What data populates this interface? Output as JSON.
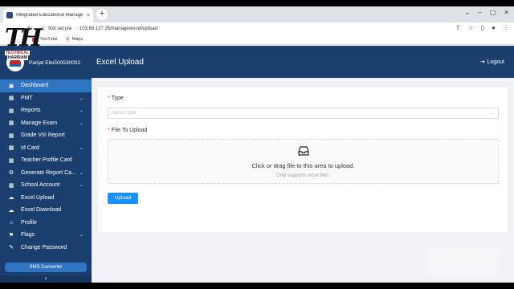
{
  "browser": {
    "tab_title": "Integrated Educational Manage",
    "tab_close": "×",
    "new_tab": "+",
    "url": "103.69.127.35/manage/excel/upload",
    "security": "Not secure",
    "bookmarks": [
      {
        "label": "YouTube",
        "icon": "youtube-icon"
      },
      {
        "label": "Maps",
        "icon": "maps-icon"
      }
    ]
  },
  "watermark": {
    "big": "TH",
    "line1": "TECHNICAL",
    "line2": "HARIRAM"
  },
  "sidebar": {
    "user_name": "Parijat Ebs500530002",
    "items": [
      {
        "label": "Dashboard",
        "icon": "▣",
        "chevron": false,
        "active": true
      },
      {
        "label": "PMT",
        "icon": "▦",
        "chevron": true,
        "active": false
      },
      {
        "label": "Reports",
        "icon": "▦",
        "chevron": true,
        "active": false
      },
      {
        "label": "Manage Exam",
        "icon": "▦",
        "chevron": true,
        "active": false
      },
      {
        "label": "Grade VIII Report",
        "icon": "▦",
        "chevron": false,
        "active": false
      },
      {
        "label": "Id Card",
        "icon": "▦",
        "chevron": true,
        "active": false
      },
      {
        "label": "Teacher Profile Card",
        "icon": "▦",
        "chevron": false,
        "active": false
      },
      {
        "label": "Generate Report Ca...",
        "icon": "⚙",
        "chevron": true,
        "active": false
      },
      {
        "label": "School Account",
        "icon": "▦",
        "chevron": true,
        "active": false
      },
      {
        "label": "Excel Upload",
        "icon": "☁",
        "chevron": false,
        "active": false
      },
      {
        "label": "Excel Download",
        "icon": "☁",
        "chevron": false,
        "active": false
      },
      {
        "label": "Profile",
        "icon": "⌂",
        "chevron": false,
        "active": false
      },
      {
        "label": "Flags",
        "icon": "⚑",
        "chevron": true,
        "active": false
      },
      {
        "label": "Change Password",
        "icon": "✎",
        "chevron": false,
        "active": false
      }
    ],
    "sms_button": "SMS Converter",
    "collapse": "‹"
  },
  "header": {
    "title": "Excel Upload",
    "logout": "Logout"
  },
  "form": {
    "type_label": "Type",
    "type_placeholder": "Select type",
    "file_label": "File To Upload",
    "drop_text": "Click or drag file to this area to upload.",
    "drop_hint": "Only supports excel files.",
    "upload_button": "Upload"
  },
  "colors": {
    "sidebar": "#1a3f6e",
    "active": "#2f74c0",
    "primary": "#1890ff",
    "required": "#e53935"
  }
}
